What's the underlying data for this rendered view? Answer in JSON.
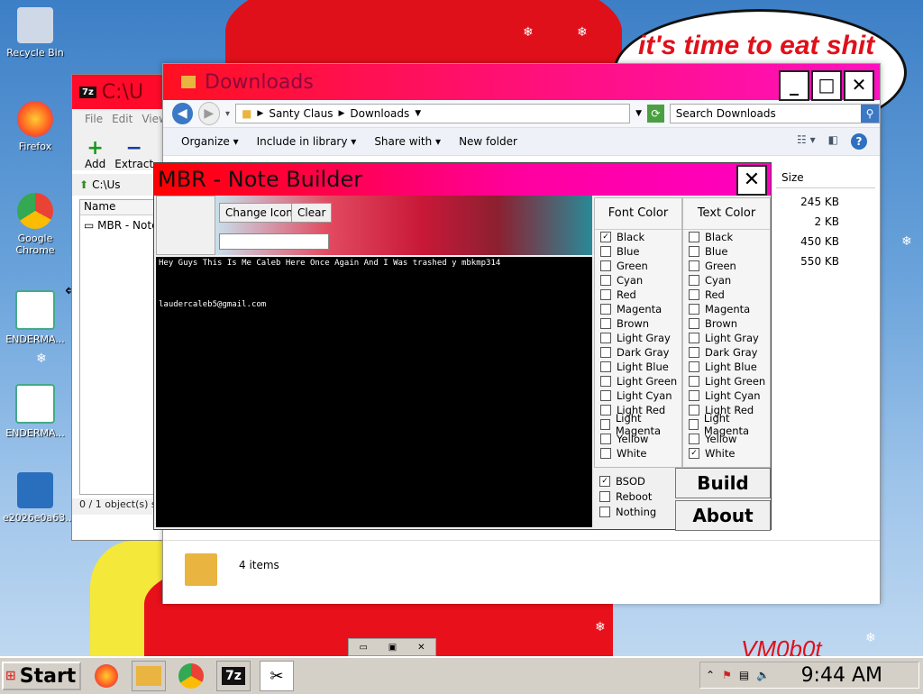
{
  "desktop": {
    "speech_text": "it's time to eat shit",
    "watermark": "VM0b0t",
    "icons": [
      {
        "label": "Recycle Bin",
        "icon": "recycle-bin-icon"
      },
      {
        "label": "Firefox",
        "icon": "firefox-icon"
      },
      {
        "label": "Google Chrome",
        "icon": "chrome-icon"
      },
      {
        "label": "ENDERMA...",
        "icon": "shortcut-icon"
      },
      {
        "label": "ENDERMA...",
        "icon": "shortcut-icon"
      },
      {
        "label": "e2026e0a63...",
        "icon": "installer-icon"
      }
    ]
  },
  "sevenzip": {
    "title": "C:\\U",
    "tag": "7z",
    "menu": [
      "File",
      "Edit",
      "View"
    ],
    "toolbar": [
      "Add",
      "Extract"
    ],
    "address": "C:\\Us",
    "column": "Name",
    "item": "MBR - Note",
    "status": "0 / 1 object(s) s"
  },
  "explorer": {
    "title": "Downloads",
    "breadcrumb": [
      "Santy Claus",
      "Downloads"
    ],
    "search_placeholder": "Search Downloads",
    "commands": [
      "Organize",
      "Include in library",
      "Share with",
      "New folder"
    ],
    "size_header": "Size",
    "sizes": [
      "245 KB",
      "2 KB",
      "450 KB",
      "550 KB"
    ],
    "status": "4 items"
  },
  "mbr": {
    "title": "MBR - Note Builder",
    "change_icon": "Change Icon",
    "clear": "Clear",
    "console_line1": "Hey Guys This Is Me Caleb Here Once Again And I Was trashed y mbkmp314",
    "console_line2": "laudercaleb5@gmail.com",
    "font_color_header": "Font Color",
    "text_color_header": "Text Color",
    "colors": [
      "Black",
      "Blue",
      "Green",
      "Cyan",
      "Red",
      "Magenta",
      "Brown",
      "Light Gray",
      "Dark Gray",
      "Light Blue",
      "Light Green",
      "Light Cyan",
      "Light Red",
      "Light Magenta",
      "Yellow",
      "White"
    ],
    "font_color_selected": "Black",
    "text_color_selected": "White",
    "actions": [
      "BSOD",
      "Reboot",
      "Nothing"
    ],
    "action_selected": "BSOD",
    "build": "Build",
    "about": "About"
  },
  "taskbar": {
    "start": "Start",
    "clock": "9:44 AM"
  }
}
